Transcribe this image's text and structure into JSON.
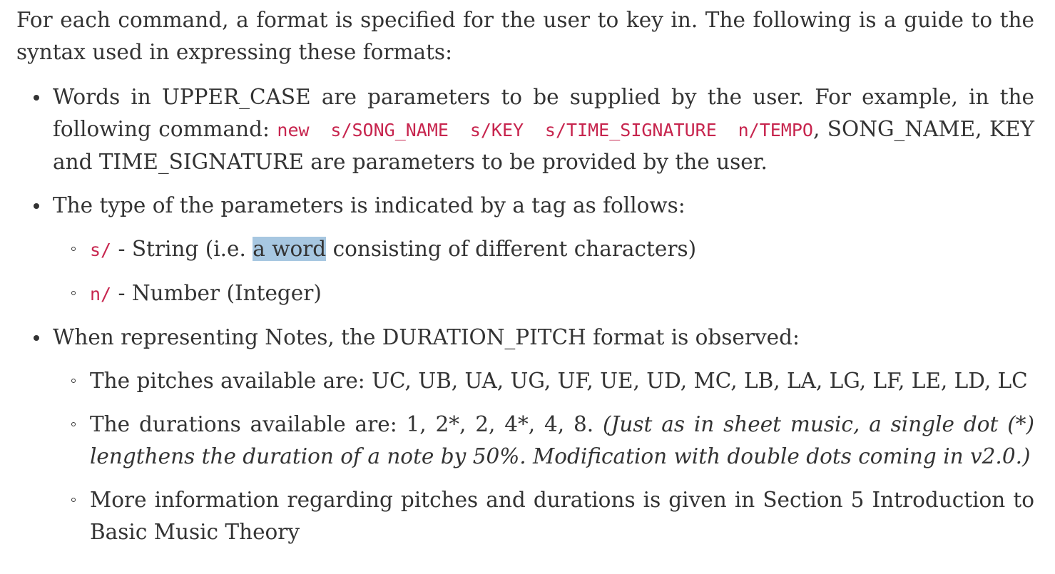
{
  "intro": "For each command, a format is specified for the user to key in. The following is a guide to the syntax used in expressing these formats:",
  "bullet1": {
    "text_before": "Words in UPPER_CASE are parameters to be supplied by the user. For example, in the following command:",
    "command": "new s/SONG_NAME s/KEY s/TIME_SIGNATURE n/TEMPO",
    "text_after": ", SONG_NAME, KEY and TIME_SIGNATURE are parameters to be provided by the user."
  },
  "bullet2": {
    "text": "The type of the parameters is indicated by a tag as follows:",
    "sub1": {
      "tag": "s/",
      "text_before": " - String (i.e. ",
      "highlighted": "a word",
      "text_after": " consisting of different characters)"
    },
    "sub2": {
      "tag": "n/",
      "text": " - Number (Integer)"
    }
  },
  "bullet3": {
    "text": "When representing Notes, the DURATION_PITCH format is observed:",
    "sub1": {
      "text": "The pitches available are: UC, UB, UA, UG, UF, UE, UD, MC, LB, LA, LG, LF, LE, LD, LC"
    },
    "sub2": {
      "text": "The durations available are: 1, 2*, 2, 4*, 4, 8. ",
      "italic": "(Just as in sheet music, a single dot (*) lengthens the duration of a note by 50%. Modification with double dots coming in v2.0.)"
    },
    "sub3": {
      "text": "More information regarding pitches and durations is given in Section 5 Introduction to Basic Music Theory"
    }
  },
  "colors": {
    "body_text": "#333333",
    "code_text": "#c7254e",
    "selection_highlight": "#a7c7e1",
    "background": "#ffffff"
  }
}
